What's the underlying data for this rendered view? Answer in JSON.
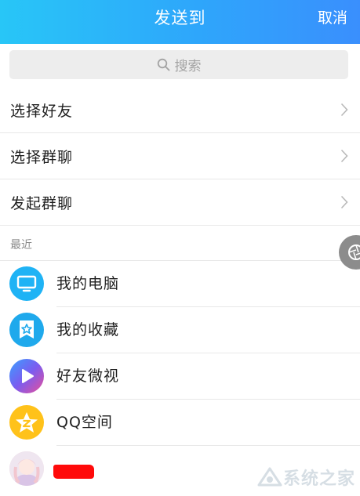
{
  "header": {
    "title": "发送到",
    "cancel_label": "取消"
  },
  "search": {
    "placeholder": "搜索"
  },
  "nav": [
    {
      "label": "选择好友"
    },
    {
      "label": "选择群聊"
    },
    {
      "label": "发起群聊"
    }
  ],
  "recent": {
    "section_label": "最近",
    "items": [
      {
        "name": "我的电脑",
        "icon": "computer-icon",
        "color": "#1fb3f5"
      },
      {
        "name": "我的收藏",
        "icon": "favorites-icon",
        "color": "#1fa9ec"
      },
      {
        "name": "好友微视",
        "icon": "weishi-icon",
        "color": "#7a5cf0"
      },
      {
        "name": "QQ空间",
        "icon": "qzone-star-icon",
        "color": "#ffc21a"
      },
      {
        "name": "",
        "icon": "user-avatar",
        "color": "#f3d9dc"
      }
    ]
  },
  "watermark": {
    "text": "系统之家"
  },
  "colors": {
    "header_start": "#28c6f7",
    "header_end": "#3a8ffd",
    "redaction": "#ff0a0a"
  }
}
